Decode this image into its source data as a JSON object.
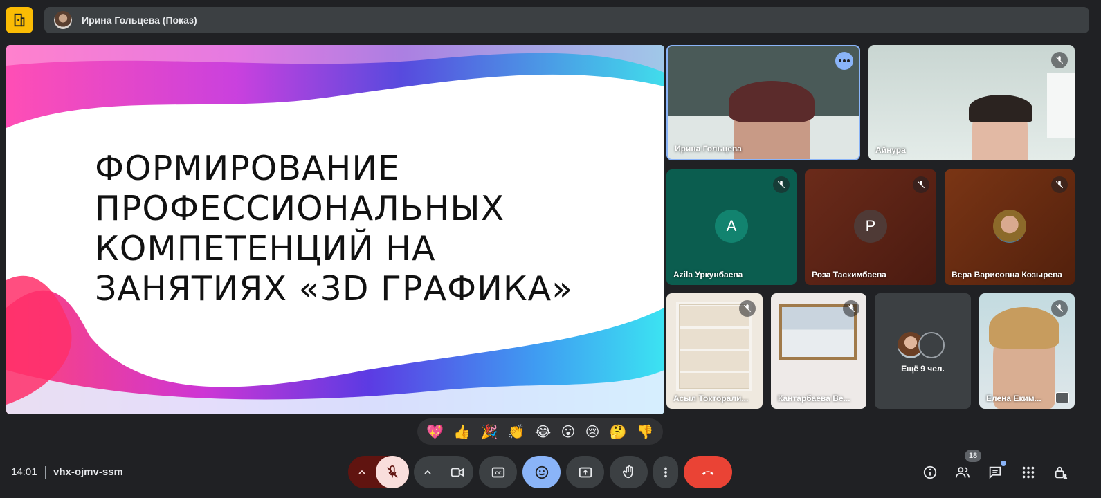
{
  "presenter": {
    "name": "Ирина Гольцева (Показ)"
  },
  "slide": {
    "title_lines": [
      "ФОРМИРОВАНИЕ",
      "ПРОФЕССИОНАЛЬНЫХ",
      "КОМПЕТЕНЦИЙ НА",
      "ЗАНЯТИЯХ «3D ГРАФИКА»"
    ]
  },
  "tiles": {
    "irina": {
      "name": "Ирина Гольцева"
    },
    "ainura": {
      "name": "Айнура"
    },
    "azila": {
      "name": "Azila Уркунбаева",
      "initial": "A"
    },
    "roza": {
      "name": "Роза Таскимбаева",
      "initial": "Р"
    },
    "vera": {
      "name": "Вера Варисовна Козырева"
    },
    "asyl": {
      "name": "Асыл Токторали..."
    },
    "kantarbaeva": {
      "name": "Кантарбаева Ве..."
    },
    "more": {
      "label": "Ещё 9 чел."
    },
    "elena": {
      "name": "Елена Еким..."
    }
  },
  "reactions": [
    "💖",
    "👍",
    "🎉",
    "👏",
    "😂",
    "😮",
    "😢",
    "🤔",
    "👎"
  ],
  "bottom": {
    "time": "14:01",
    "meeting_code": "vhx-ojmv-ssm",
    "participants_count": "18"
  },
  "colors": {
    "accent": "#8ab4f8",
    "end_call": "#ea4335",
    "mic_muted_bg": "#f9dedc",
    "mic_muted_dark": "#601410",
    "app_icon": "#fbbc04"
  }
}
